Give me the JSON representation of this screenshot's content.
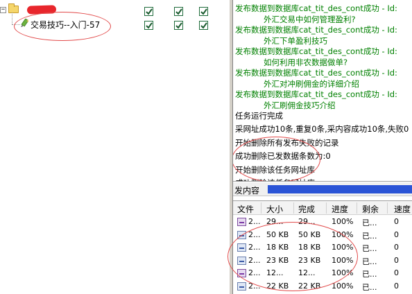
{
  "tree": {
    "expander_glyph": "−",
    "root_label_visible": "",
    "child": {
      "label": "交易技巧--入门-57"
    }
  },
  "checkboxes": {
    "columns": 3,
    "rows": [
      {
        "checked": [
          true,
          true,
          true
        ]
      },
      {
        "checked": [
          true,
          true,
          true
        ]
      }
    ]
  },
  "log": {
    "lines": [
      {
        "text": "发布数据到数据库cat_tit_des_cont成功 - Id:",
        "color": "green",
        "indent": false
      },
      {
        "text": "外汇交易中如何管理盈利?",
        "color": "green",
        "indent": true
      },
      {
        "text": "发布数据到数据库cat_tit_des_cont成功 - Id:",
        "color": "green",
        "indent": false
      },
      {
        "text": "外汇下单盈利技巧",
        "color": "green",
        "indent": true
      },
      {
        "text": "发布数据到数据库cat_tit_des_cont成功 - Id:",
        "color": "green",
        "indent": false
      },
      {
        "text": "如何利用非农数据做单?",
        "color": "green",
        "indent": true
      },
      {
        "text": "发布数据到数据库cat_tit_des_cont成功 - Id:",
        "color": "green",
        "indent": false
      },
      {
        "text": "外汇对冲刷佣金的详细介绍",
        "color": "green",
        "indent": true
      },
      {
        "text": "发布数据到数据库cat_tit_des_cont成功 - Id:",
        "color": "green",
        "indent": false
      },
      {
        "text": "外汇刷佣金技巧介绍",
        "color": "green",
        "indent": true
      },
      {
        "text": "任务运行完成",
        "color": "black",
        "indent": false
      },
      {
        "text": "采网址成功10条,重复0条,采内容成功10条,失败0",
        "color": "black",
        "indent": false
      },
      {
        "text": "开始删除所有发布失败的记录",
        "color": "black",
        "indent": false
      },
      {
        "text": "成功删除已发数据条数为:0",
        "color": "black",
        "indent": false
      },
      {
        "text": "开始删除该任务网址库",
        "color": "black",
        "indent": false
      },
      {
        "text": "成功删除该任务网址库",
        "color": "black",
        "indent": false
      }
    ]
  },
  "progress": {
    "label": "发内容",
    "fill_fraction": 1.0,
    "color": "#2b54d6"
  },
  "file_table": {
    "headers": [
      "文件",
      "大小",
      "完成",
      "进度",
      "剩余",
      "速度"
    ],
    "rows": [
      {
        "icon": "image-file-icon",
        "alt": true,
        "file": "2...",
        "size": "29...",
        "done": "29...",
        "progress": "100%",
        "remaining": "已...",
        "speed": "0"
      },
      {
        "icon": "image-file-icon",
        "alt": false,
        "file": "2...",
        "size": "50 KB",
        "done": "50 KB",
        "progress": "100%",
        "remaining": "已...",
        "speed": "0"
      },
      {
        "icon": "image-file-icon",
        "alt": false,
        "file": "2...",
        "size": "18 KB",
        "done": "18 KB",
        "progress": "100%",
        "remaining": "已...",
        "speed": "0"
      },
      {
        "icon": "image-file-icon",
        "alt": false,
        "file": "2...",
        "size": "23 KB",
        "done": "23 KB",
        "progress": "100%",
        "remaining": "已...",
        "speed": "0"
      },
      {
        "icon": "image-file-icon",
        "alt": true,
        "file": "2...",
        "size": "12...",
        "done": "12...",
        "progress": "100%",
        "remaining": "已...",
        "speed": "0"
      },
      {
        "icon": "image-file-icon",
        "alt": false,
        "file": "2...",
        "size": "22 KB",
        "done": "22 KB",
        "progress": "100%",
        "remaining": "已...",
        "speed": "0"
      }
    ]
  },
  "colors": {
    "log_green": "#008000",
    "annotation_red": "#e24a4a",
    "checkbox_green": "#1e6b3a"
  }
}
